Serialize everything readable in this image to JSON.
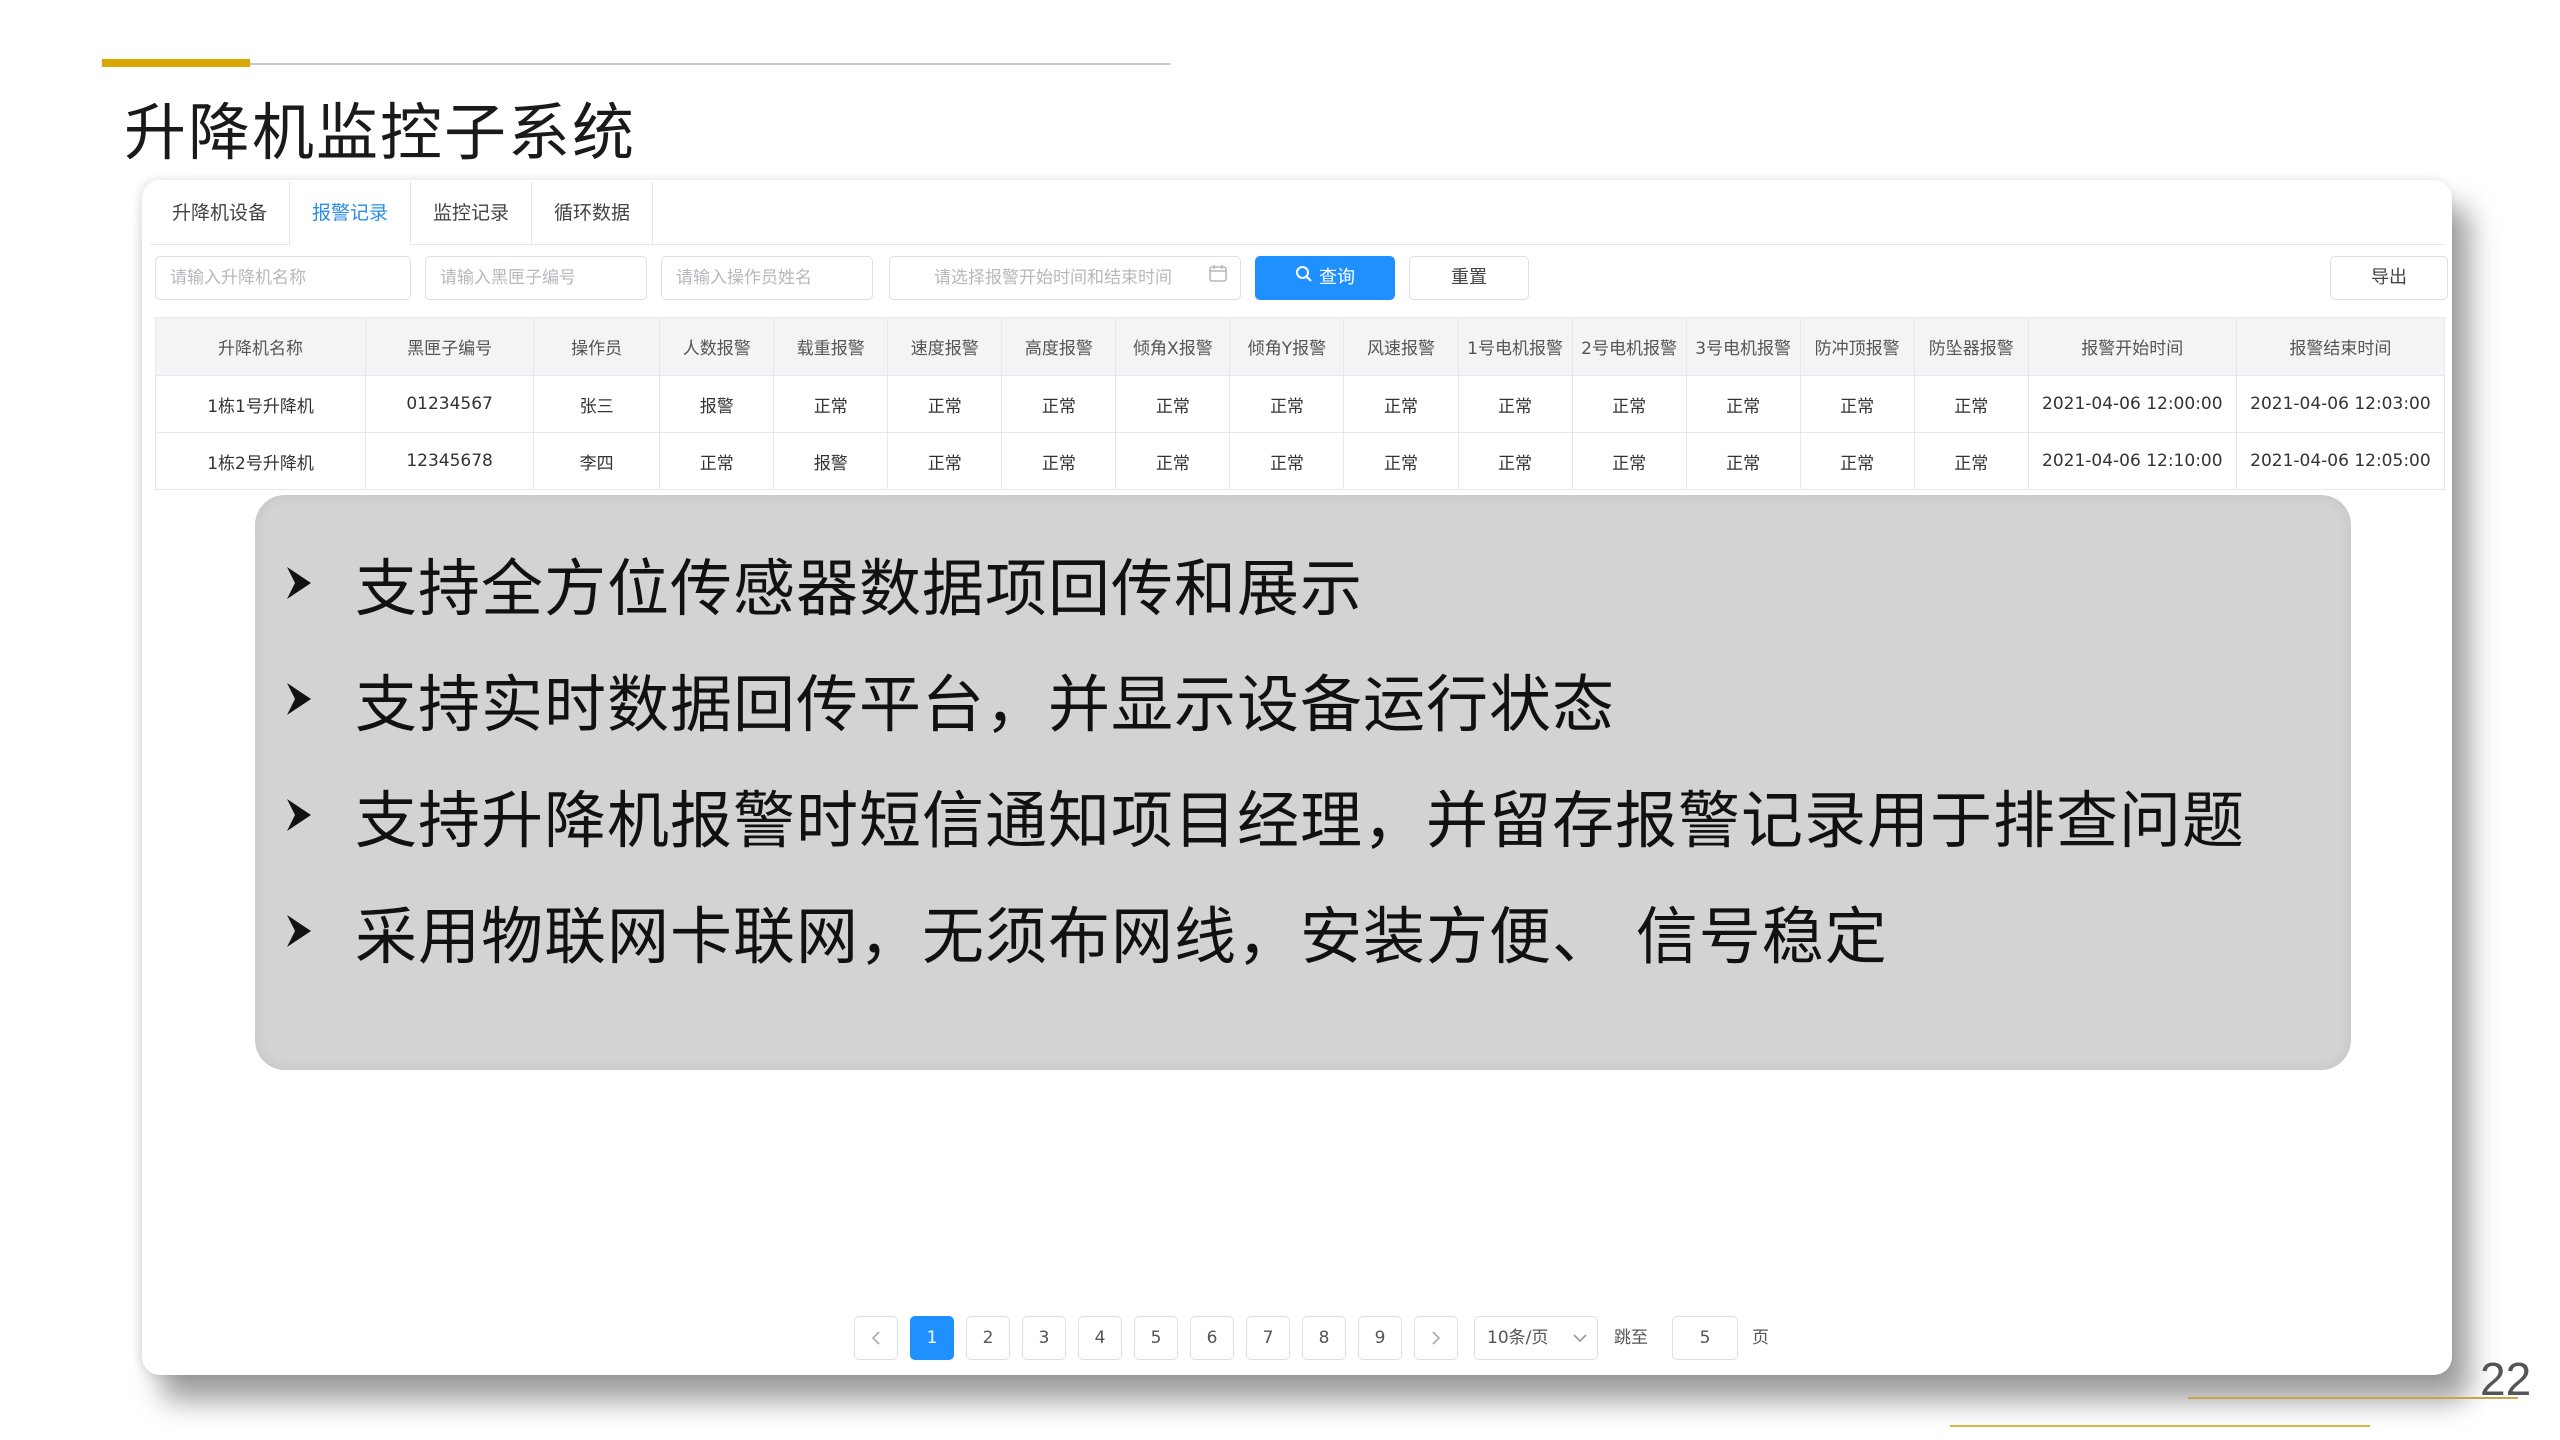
{
  "slide": {
    "title": "升降机监控子系统",
    "page_number": "22",
    "accent_color": "#d9a800"
  },
  "tabs": [
    {
      "label": "升降机设备",
      "active": false
    },
    {
      "label": "报警记录",
      "active": true
    },
    {
      "label": "监控记录",
      "active": false
    },
    {
      "label": "循环数据",
      "active": false
    }
  ],
  "filters": {
    "name_placeholder": "请输入升降机名称",
    "blackbox_placeholder": "请输入黑匣子编号",
    "operator_placeholder": "请输入操作员姓名",
    "date_range_placeholder": "请选择报警开始时间和结束时间",
    "query_label": "查询",
    "reset_label": "重置",
    "export_label": "导出"
  },
  "table": {
    "columns": [
      "升降机名称",
      "黑匣子编号",
      "操作员",
      "人数报警",
      "载重报警",
      "速度报警",
      "高度报警",
      "倾角X报警",
      "倾角Y报警",
      "风速报警",
      "1号电机报警",
      "2号电机报警",
      "3号电机报警",
      "防冲顶报警",
      "防坠器报警",
      "报警开始时间",
      "报警结束时间"
    ],
    "rows": [
      [
        "1栋1号升降机",
        "01234567",
        "张三",
        "报警",
        "正常",
        "正常",
        "正常",
        "正常",
        "正常",
        "正常",
        "正常",
        "正常",
        "正常",
        "正常",
        "正常",
        "2021-04-06 12:00:00",
        "2021-04-06 12:03:00"
      ],
      [
        "1栋2号升降机",
        "12345678",
        "李四",
        "正常",
        "报警",
        "正常",
        "正常",
        "正常",
        "正常",
        "正常",
        "正常",
        "正常",
        "正常",
        "正常",
        "正常",
        "2021-04-06 12:10:00",
        "2021-04-06 12:05:00"
      ]
    ],
    "status_colors": {
      "正常": "#19b32a",
      "报警": "#f02a2a"
    }
  },
  "overlay": {
    "bullets": [
      "支持全方位传感器数据项回传和展示",
      "支持实时数据回传平台，并显示设备运行状态",
      "支持升降机报警时短信通知项目经理，并留存报警记录用于排查问题",
      "采用物联网卡联网，无须布网线，安装方便、 信号稳定"
    ]
  },
  "pagination": {
    "pages": [
      "1",
      "2",
      "3",
      "4",
      "5",
      "6",
      "7",
      "8",
      "9"
    ],
    "current": "1",
    "prev_icon": "chevron-left-icon",
    "next_icon": "chevron-right-icon",
    "page_size_label": "10条/页",
    "jump_label": "跳至",
    "jump_value": "5",
    "page_suffix": "页"
  }
}
